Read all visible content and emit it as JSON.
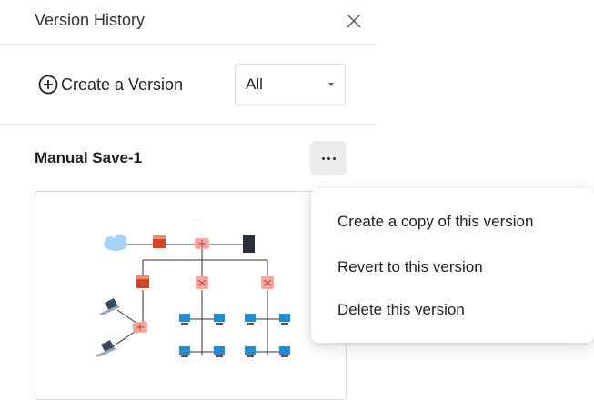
{
  "panel": {
    "title": "Version History",
    "close_icon": "close-icon"
  },
  "toolbar": {
    "create_label": "Create a Version",
    "create_icon": "plus-circle-icon",
    "filter": {
      "selected": "All",
      "icon": "caret-down-icon"
    }
  },
  "version": {
    "title": "Manual Save-1",
    "more_icon": "more-horizontal-icon",
    "thumbnail": "network-diagram-thumbnail"
  },
  "context_menu": {
    "items": [
      {
        "label": "Create a copy of this version"
      },
      {
        "label": "Revert to this version"
      },
      {
        "label": "Delete this version"
      }
    ]
  },
  "colors": {
    "divider": "#e6e6e6",
    "more_button_bg": "#ececec",
    "cloud": "#a9d3f5",
    "firewall": "#d4462a",
    "router": "#f4a6a0",
    "server": "#2a2f3a",
    "monitor": "#1b8fd6"
  }
}
